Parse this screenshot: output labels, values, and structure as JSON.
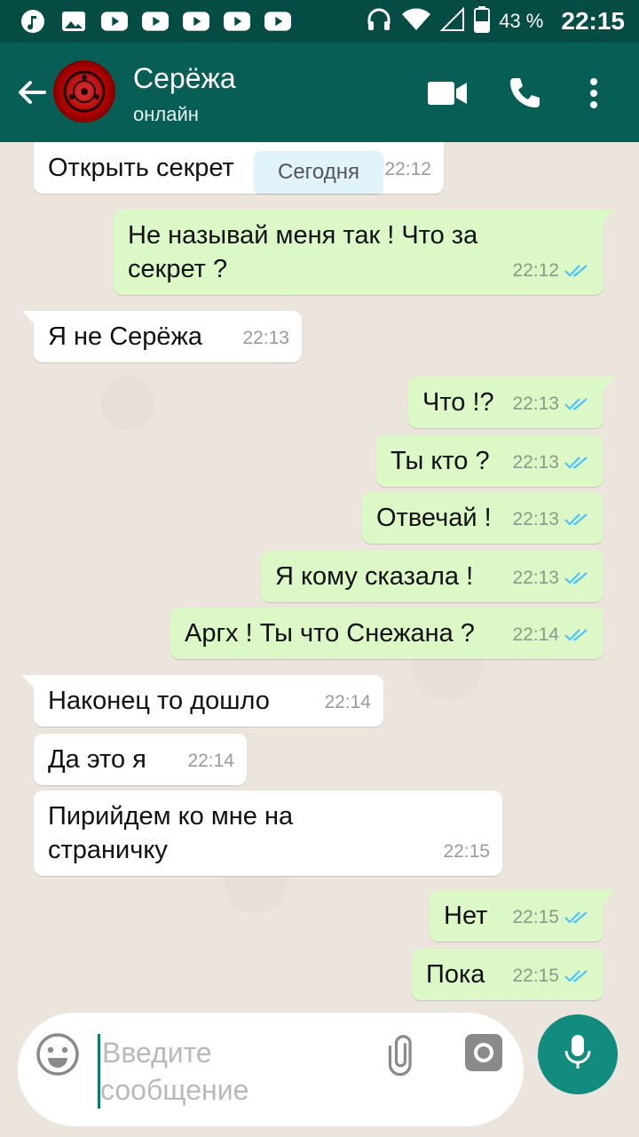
{
  "status_bar": {
    "battery_percent": "43 %",
    "time": "22:15"
  },
  "header": {
    "contact_name": "Серёжа",
    "contact_status": "онлайн"
  },
  "chat": {
    "date_chip": "Сегодня",
    "messages": [
      {
        "dir": "in",
        "text": "Открыть секрет",
        "time": "22:12"
      },
      {
        "dir": "out",
        "text": "Не называй меня так !  Что за секрет ?",
        "time": "22:12",
        "read": true
      },
      {
        "dir": "in",
        "text": "Я не Серёжа",
        "time": "22:13"
      },
      {
        "dir": "out",
        "text": "Что !?",
        "time": "22:13",
        "read": true
      },
      {
        "dir": "out",
        "text": "Ты кто ?",
        "time": "22:13",
        "read": true
      },
      {
        "dir": "out",
        "text": "Отвечай !",
        "time": "22:13",
        "read": true
      },
      {
        "dir": "out",
        "text": "Я кому сказала !",
        "time": "22:13",
        "read": true
      },
      {
        "dir": "out",
        "text": "Аргх ! Ты что Снежана ?",
        "time": "22:14",
        "read": true
      },
      {
        "dir": "in",
        "text": "Наконец то дошло",
        "time": "22:14"
      },
      {
        "dir": "in",
        "text": "Да это я",
        "time": "22:14"
      },
      {
        "dir": "in",
        "text": "Пирийдем ко мне на страничку",
        "time": "22:15"
      },
      {
        "dir": "out",
        "text": "Нет",
        "time": "22:15",
        "read": true
      },
      {
        "dir": "out",
        "text": "Пока",
        "time": "22:15",
        "read": true
      }
    ]
  },
  "composer": {
    "placeholder": "Введите сообщение"
  },
  "colors": {
    "header": "#075e54",
    "statusbar": "#054d44",
    "outgoing_bubble": "#dcf8c6",
    "incoming_bubble": "#ffffff",
    "read_ticks": "#4fc3f7",
    "mic_button": "#128c7e"
  },
  "icons": [
    "music-note-icon",
    "image-icon",
    "youtube-icon",
    "headphones-icon",
    "wifi-icon",
    "signal-icon",
    "battery-icon",
    "back-arrow-icon",
    "video-call-icon",
    "phone-icon",
    "more-vert-icon",
    "emoji-icon",
    "attach-icon",
    "camera-icon",
    "mic-icon",
    "double-check-icon"
  ]
}
